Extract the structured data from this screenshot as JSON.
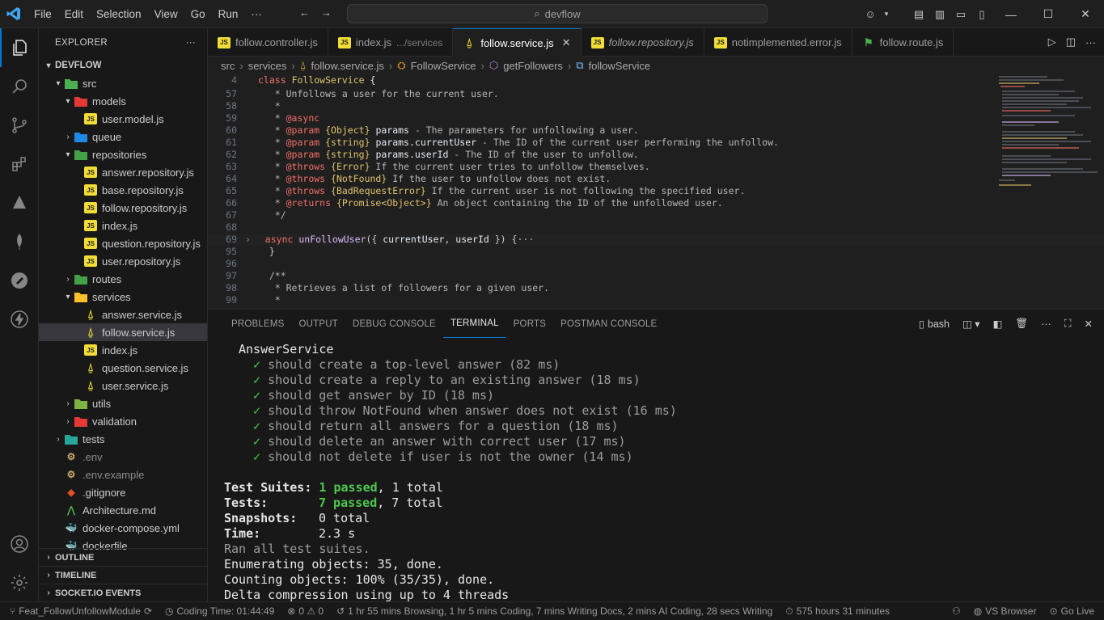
{
  "titlebar": {
    "menu": [
      "File",
      "Edit",
      "Selection",
      "View",
      "Go",
      "Run",
      "···"
    ],
    "search": "devflow"
  },
  "explorer": {
    "header": "EXPLORER",
    "root": "DEVFLOW",
    "items": [
      {
        "label": "src",
        "kind": "folder",
        "depth": 1,
        "open": true
      },
      {
        "label": "models",
        "kind": "folder",
        "depth": 2,
        "open": true
      },
      {
        "label": "user.model.js",
        "kind": "js",
        "depth": 3
      },
      {
        "label": "queue",
        "kind": "folder",
        "depth": 2,
        "open": false
      },
      {
        "label": "repositories",
        "kind": "folder",
        "depth": 2,
        "open": true
      },
      {
        "label": "answer.repository.js",
        "kind": "js",
        "depth": 3
      },
      {
        "label": "base.repository.js",
        "kind": "js",
        "depth": 3
      },
      {
        "label": "follow.repository.js",
        "kind": "js",
        "depth": 3
      },
      {
        "label": "index.js",
        "kind": "js",
        "depth": 3
      },
      {
        "label": "question.repository.js",
        "kind": "js",
        "depth": 3
      },
      {
        "label": "user.repository.js",
        "kind": "js",
        "depth": 3
      },
      {
        "label": "routes",
        "kind": "folder",
        "depth": 2,
        "open": false
      },
      {
        "label": "services",
        "kind": "folder",
        "depth": 2,
        "open": true
      },
      {
        "label": "answer.service.js",
        "kind": "svc",
        "depth": 3
      },
      {
        "label": "follow.service.js",
        "kind": "svc",
        "depth": 3,
        "selected": true
      },
      {
        "label": "index.js",
        "kind": "js",
        "depth": 3
      },
      {
        "label": "question.service.js",
        "kind": "svc",
        "depth": 3
      },
      {
        "label": "user.service.js",
        "kind": "svc",
        "depth": 3
      },
      {
        "label": "utils",
        "kind": "folder",
        "depth": 2,
        "open": false
      },
      {
        "label": "validation",
        "kind": "folder",
        "depth": 2,
        "open": false
      },
      {
        "label": "tests",
        "kind": "folder",
        "depth": 1,
        "open": false
      },
      {
        "label": ".env",
        "kind": "env",
        "depth": 1
      },
      {
        "label": ".env.example",
        "kind": "env",
        "depth": 1
      },
      {
        "label": ".gitignore",
        "kind": "git",
        "depth": 1
      },
      {
        "label": "Architecture.md",
        "kind": "md",
        "depth": 1
      },
      {
        "label": "docker-compose.yml",
        "kind": "docker",
        "depth": 1
      },
      {
        "label": "dockerfile",
        "kind": "docker",
        "depth": 1
      }
    ],
    "sections": [
      "OUTLINE",
      "TIMELINE",
      "SOCKET.IO EVENTS"
    ]
  },
  "tabs": [
    {
      "label": "follow.controller.js",
      "icon": "js"
    },
    {
      "label": "index.js",
      "desc": ".../services",
      "icon": "js"
    },
    {
      "label": "follow.service.js",
      "icon": "svc",
      "active": true
    },
    {
      "label": "follow.repository.js",
      "icon": "js",
      "italic": true
    },
    {
      "label": "notimplemented.error.js",
      "icon": "js"
    },
    {
      "label": "follow.route.js",
      "icon": "route"
    }
  ],
  "breadcrumb": [
    "src",
    "services",
    "follow.service.js",
    "FollowService",
    "getFollowers",
    "followService"
  ],
  "editor": {
    "lines": [
      {
        "n": "4",
        "html": "<span class='c-kw'>class</span> <span class='c-type'>FollowService</span> {",
        "indent": 0
      },
      {
        "n": "57",
        "html": "<span class='c-com'>   * Unfollows a user for the current user.</span>"
      },
      {
        "n": "58",
        "html": "<span class='c-com'>   *</span>"
      },
      {
        "n": "59",
        "html": "<span class='c-com'>   * </span><span class='c-tag'>@async</span>"
      },
      {
        "n": "60",
        "html": "<span class='c-com'>   * </span><span class='c-tag'>@param</span> <span class='c-type'>{Object}</span> <span class='c-var'>params</span><span class='c-com'> - The parameters for unfollowing a user.</span>"
      },
      {
        "n": "61",
        "html": "<span class='c-com'>   * </span><span class='c-tag'>@param</span> <span class='c-type'>{string}</span> <span class='c-var'>params.currentUser</span><span class='c-com'> - The ID of the current user performing the unfollow.</span>"
      },
      {
        "n": "62",
        "html": "<span class='c-com'>   * </span><span class='c-tag'>@param</span> <span class='c-type'>{string}</span> <span class='c-var'>params.userId</span><span class='c-com'> - The ID of the user to unfollow.</span>"
      },
      {
        "n": "63",
        "html": "<span class='c-com'>   * </span><span class='c-tag'>@throws</span> <span class='c-type'>{Error}</span><span class='c-com'> If the current user tries to unfollow themselves.</span>"
      },
      {
        "n": "64",
        "html": "<span class='c-com'>   * </span><span class='c-tag'>@throws</span> <span class='c-type'>{NotFound}</span><span class='c-com'> If the user to unfollow does not exist.</span>"
      },
      {
        "n": "65",
        "html": "<span class='c-com'>   * </span><span class='c-tag'>@throws</span> <span class='c-type'>{BadRequestError}</span><span class='c-com'> If the current user is not following the specified user.</span>"
      },
      {
        "n": "66",
        "html": "<span class='c-com'>   * </span><span class='c-tag'>@returns</span> <span class='c-type'>{Promise&lt;Object&gt;}</span><span class='c-com'> An object containing the ID of the unfollowed user.</span>"
      },
      {
        "n": "67",
        "html": "<span class='c-com'>   */</span>"
      },
      {
        "n": "68",
        "html": ""
      },
      {
        "n": "69",
        "html": "  <span class='c-kw'>async</span> <span class='c-fn'>unFollowUser</span>({ <span class='c-var'>currentUser</span>, <span class='c-var'>userId</span> }) {<span class='c-com'>···</span>",
        "cur": true
      },
      {
        "n": "95",
        "html": "  }"
      },
      {
        "n": "96",
        "html": ""
      },
      {
        "n": "97",
        "html": "  <span class='c-com'>/**</span>"
      },
      {
        "n": "98",
        "html": "<span class='c-com'>   * Retrieves a list of followers for a given user.</span>"
      },
      {
        "n": "99",
        "html": "<span class='c-com'>   *</span>"
      }
    ]
  },
  "panel": {
    "tabs": [
      "PROBLEMS",
      "OUTPUT",
      "DEBUG CONSOLE",
      "TERMINAL",
      "PORTS",
      "POSTMAN CONSOLE"
    ],
    "active_tab": "TERMINAL",
    "shell": "bash",
    "terminal": {
      "suite": "AnswerService",
      "tests": [
        "should create a top-level answer (82 ms)",
        "should create a reply to an existing answer (18 ms)",
        "should get answer by ID (18 ms)",
        "should throw NotFound when answer does not exist (16 ms)",
        "should return all answers for a question (18 ms)",
        "should delete an answer with correct user (17 ms)",
        "should not delete if user is not the owner (14 ms)"
      ],
      "summary": {
        "suites_label": "Test Suites:",
        "suites_pass": "1 passed",
        "suites_total": ", 1 total",
        "tests_label": "Tests:",
        "tests_pass": "7 passed",
        "tests_total": ", 7 total",
        "snap_label": "Snapshots:",
        "snap_val": "0 total",
        "time_label": "Time:",
        "time_val": "2.3 s"
      },
      "after": [
        "Ran all test suites.",
        "Enumerating objects: 35, done.",
        "Counting objects: 100% (35/35), done.",
        "Delta compression using up to 4 threads"
      ]
    }
  },
  "status": {
    "branch": "Feat_FollowUnfollowModule",
    "coding_time": "Coding Time: 01:44:49",
    "problems": "0 ⚠ 0",
    "activity": "1 hr 55 mins Browsing, 1 hr 5 mins Coding, 7 mins Writing Docs, 2 mins AI Coding, 28 secs Writing",
    "hours": "575 hours 31 minutes",
    "vs_browser": "VS Browser",
    "go_live": "Go Live"
  },
  "colors": {
    "accent": "#0078d4",
    "js": "#f1dd35",
    "pass": "#4ec94e"
  }
}
